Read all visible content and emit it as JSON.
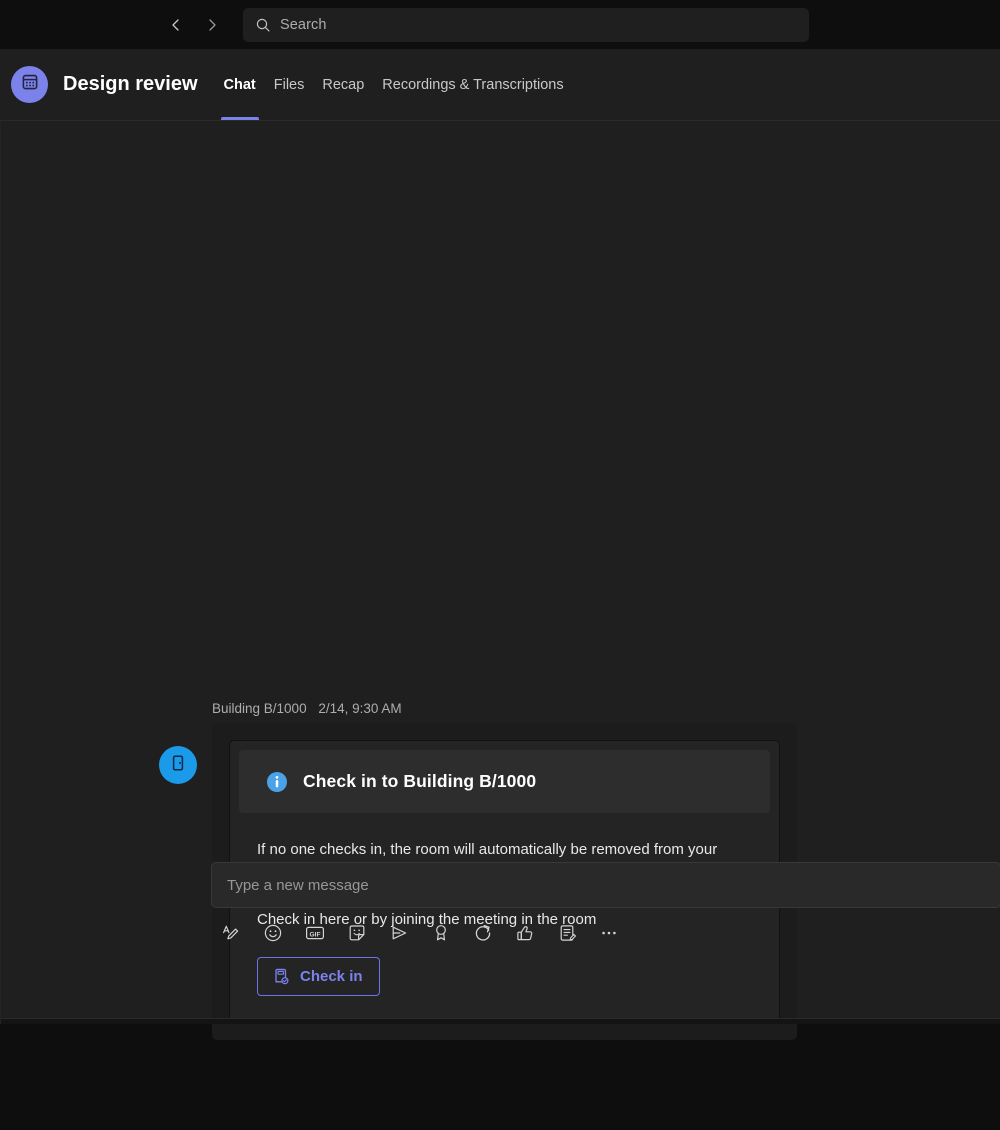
{
  "topbar": {
    "back_icon": "chevron-left-icon",
    "forward_icon": "chevron-right-icon",
    "search": {
      "icon": "search-icon",
      "placeholder": "Search",
      "value": ""
    }
  },
  "chat_header": {
    "avatar_icon": "calendar-meeting-icon",
    "title": "Design review",
    "tabs": [
      {
        "label": "Chat",
        "active": true
      },
      {
        "label": "Files",
        "active": false
      },
      {
        "label": "Recap",
        "active": false
      },
      {
        "label": "Recordings & Transcriptions",
        "active": false
      }
    ],
    "accent_color": "#7b83eb"
  },
  "message": {
    "avatar_icon": "door-room-icon",
    "avatar_color": "#1a9ae8",
    "sender": "Building B/1000",
    "timestamp": "2/14, 9:30 AM",
    "card": {
      "banner": {
        "icon": "info-circle-icon",
        "icon_color": "#4aa3e8",
        "title": "Check in to Building B/1000"
      },
      "paragraphs": [
        "If no one checks in, the room will automatically be removed from your meeting to make it available to others.",
        "Check in here or by joining the meeting in the room"
      ],
      "action": {
        "icon": "room-check-icon",
        "label": "Check in",
        "color": "#7b83eb"
      }
    }
  },
  "composer": {
    "placeholder": "Type a new message",
    "value": "",
    "tools": [
      {
        "name": "format-icon"
      },
      {
        "name": "emoji-icon"
      },
      {
        "name": "gif-icon"
      },
      {
        "name": "sticker-icon"
      },
      {
        "name": "send-plane-icon"
      },
      {
        "name": "praise-ribbon-icon"
      },
      {
        "name": "loop-icon"
      },
      {
        "name": "approvals-icon"
      },
      {
        "name": "forms-icon"
      },
      {
        "name": "more-options-icon"
      }
    ]
  }
}
